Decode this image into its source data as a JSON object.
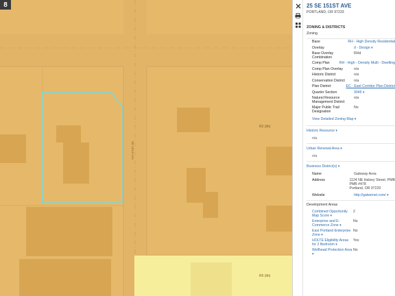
{
  "map": {
    "page_indicator": "8",
    "zone_labels": [
      "R2 (ith)",
      "R5 (ith)"
    ],
    "street_label": "SE 151st Ave",
    "colors": {
      "zone_rh": "#e6b96a",
      "zone_r5": "#f7ee9c",
      "selected_outline": "#7fd6d6",
      "building": "#d8a653"
    }
  },
  "toolbar": {
    "icons": [
      "close-icon",
      "print-icon",
      "layers-icon"
    ]
  },
  "property": {
    "address": "25 SE 151ST AVE",
    "city": "PORTLAND, OR 97233"
  },
  "zoning": {
    "section_title": "ZONING & DISTRICTS",
    "subsection": "Zoning",
    "rows": [
      {
        "k": "Base",
        "v": "RH - High Density Residential",
        "link": true
      },
      {
        "k": "Overlay",
        "v": "d - Design ▾",
        "link": true
      },
      {
        "k": "Base Overlay Combination",
        "v": "RHd",
        "link": false
      },
      {
        "k": "Comp Plan",
        "v": "RH - High - Density Multi - Dwelling",
        "link": true
      },
      {
        "k": "Comp Plan Overlay",
        "v": "n/a",
        "link": false
      },
      {
        "k": "Historic District",
        "v": "n/a",
        "link": false
      },
      {
        "k": "Conservation District",
        "v": "n/a",
        "link": false
      },
      {
        "k": "Plan District",
        "v": "EC - East Corridor Plan District",
        "link": true
      },
      {
        "k": "Quarter Section",
        "v": "3045 ▾",
        "link": true
      },
      {
        "k": "Natural Resource Management District",
        "v": "n/a",
        "link": false
      },
      {
        "k": "Major Public Trail Designation",
        "v": "No",
        "link": false
      }
    ],
    "detail_link": "View Detailed Zoning Map ▾"
  },
  "historic": {
    "title": "Historic Resource ▾",
    "value": "n/a"
  },
  "urban_renewal": {
    "title": "Urban Renewal Area ▾",
    "value": "n/a"
  },
  "business": {
    "title": "Business District(s) ▾",
    "name_label": "Name",
    "name_value": "Gateway Area",
    "address_label": "Address",
    "address_lines": [
      "1124 NE Halsey Street, PMB",
      "PMB #478",
      "Portland, OR 97220"
    ],
    "website_label": "Website",
    "website_value": "http://gatwenet.com/ ▾"
  },
  "development": {
    "title": "Development Areas",
    "rows": [
      {
        "k": "Combined Opportunity Map Score ▾",
        "v": "2"
      },
      {
        "k": "Enterprise and E-Commerce Zone ▾",
        "v": "No"
      },
      {
        "k": "East Portland Enterprise Zone ▾",
        "v": "No"
      },
      {
        "k": "HOLTE Eligibility Areas for 2 Bedroom ▾",
        "v": "Yes"
      },
      {
        "k": "Wellhead Protection Area ▾",
        "v": "No"
      }
    ]
  }
}
